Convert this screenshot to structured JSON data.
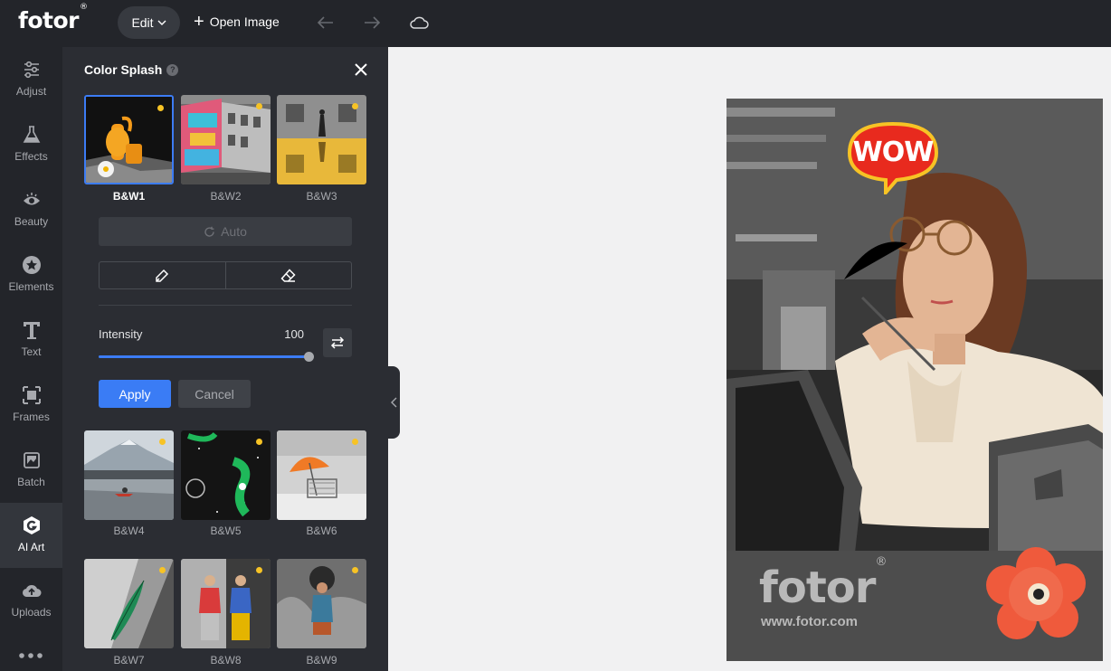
{
  "topbar": {
    "logo": "fotor",
    "logo_mark": "®",
    "edit_label": "Edit",
    "open_image_label": "Open Image",
    "icons": [
      "undo-icon",
      "redo-icon",
      "cloud-icon"
    ]
  },
  "rail": {
    "items": [
      {
        "label": "Adjust",
        "icon": "sliders-icon"
      },
      {
        "label": "Effects",
        "icon": "flask-icon"
      },
      {
        "label": "Beauty",
        "icon": "eye-icon"
      },
      {
        "label": "Elements",
        "icon": "star-icon"
      },
      {
        "label": "Text",
        "icon": "text-icon"
      },
      {
        "label": "Frames",
        "icon": "frame-icon"
      },
      {
        "label": "Batch",
        "icon": "batch-icon"
      },
      {
        "label": "AI Art",
        "icon": "ai-art-icon",
        "active": true
      },
      {
        "label": "Uploads",
        "icon": "upload-cloud-icon"
      }
    ],
    "more_icon": "more-dots-icon"
  },
  "panel": {
    "title": "Color Splash",
    "help": "?",
    "auto_label": "Auto",
    "intensity_label": "Intensity",
    "intensity_value": "100",
    "intensity_fraction": 1.0,
    "apply_label": "Apply",
    "cancel_label": "Cancel",
    "presets": [
      {
        "label": "B&W1",
        "selected": true
      },
      {
        "label": "B&W2"
      },
      {
        "label": "B&W3"
      },
      {
        "label": "B&W4"
      },
      {
        "label": "B&W5"
      },
      {
        "label": "B&W6"
      },
      {
        "label": "B&W7"
      },
      {
        "label": "B&W8"
      },
      {
        "label": "B&W9"
      }
    ]
  },
  "canvas": {
    "sticker_text": "WOW",
    "watermark": "fotor",
    "watermark_mark": "®",
    "watermark_url": "www.fotor.com"
  },
  "colors": {
    "accent": "#3a7cf5",
    "badge": "#f7c325",
    "bg_dark": "#23252a",
    "panel": "#2b2d33"
  }
}
